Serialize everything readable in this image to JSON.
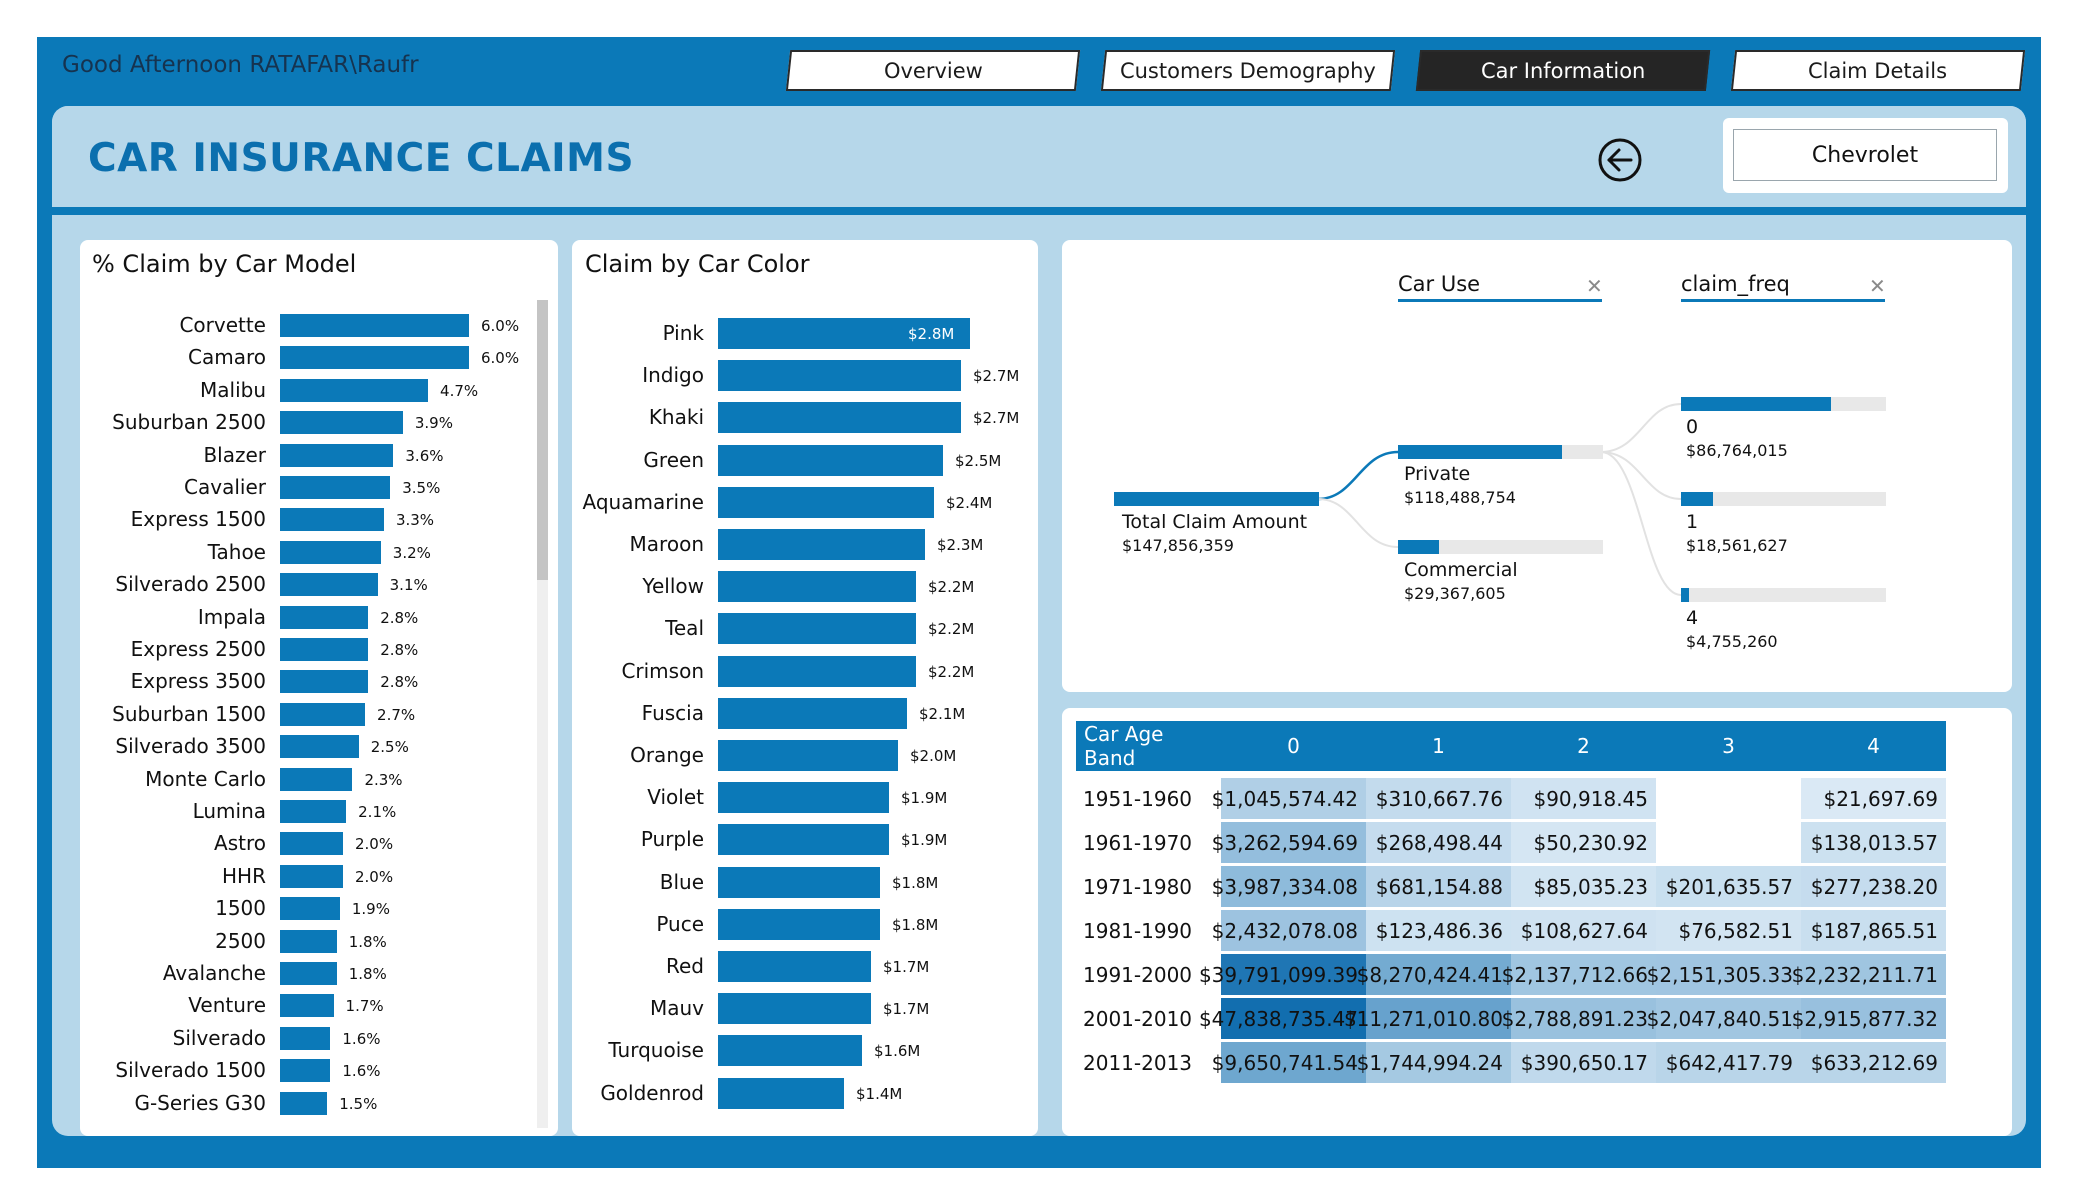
{
  "header": {
    "greeting": "Good Afternoon RATAFAR\\Raufr",
    "tabs": [
      {
        "label": "Overview",
        "active": false
      },
      {
        "label": "Customers Demography",
        "active": false
      },
      {
        "label": "Car Information",
        "active": true
      },
      {
        "label": "Claim Details",
        "active": false
      }
    ],
    "title": "CAR INSURANCE CLAIMS",
    "back_icon": "back-arrow-circle-icon",
    "brand_filter": "Chevrolet"
  },
  "colors": {
    "frame": "#0b79b8",
    "panel_bg": "#b6d7ea",
    "bar": "#0b79b8",
    "title": "#0b6fae",
    "active_tab": "#252525"
  },
  "model_chart": {
    "title": "% Claim by Car Model",
    "chart_data": {
      "type": "bar",
      "orientation": "horizontal",
      "categories": [
        "Corvette",
        "Camaro",
        "Malibu",
        "Suburban 2500",
        "Blazer",
        "Cavalier",
        "Express 1500",
        "Tahoe",
        "Silverado 2500",
        "Impala",
        "Express 2500",
        "Express 3500",
        "Suburban 1500",
        "Silverado 3500",
        "Monte Carlo",
        "Lumina",
        "Astro",
        "HHR",
        "1500",
        "2500",
        "Avalanche",
        "Venture",
        "Silverado",
        "Silverado 1500",
        "G-Series G30"
      ],
      "values": [
        6.0,
        6.0,
        4.7,
        3.9,
        3.6,
        3.5,
        3.3,
        3.2,
        3.1,
        2.8,
        2.8,
        2.8,
        2.7,
        2.5,
        2.3,
        2.1,
        2.0,
        2.0,
        1.9,
        1.8,
        1.8,
        1.7,
        1.6,
        1.6,
        1.5
      ],
      "value_labels": [
        "6.0%",
        "6.0%",
        "4.7%",
        "3.9%",
        "3.6%",
        "3.5%",
        "3.3%",
        "3.2%",
        "3.1%",
        "2.8%",
        "2.8%",
        "2.8%",
        "2.7%",
        "2.5%",
        "2.3%",
        "2.1%",
        "2.0%",
        "2.0%",
        "1.9%",
        "1.8%",
        "1.8%",
        "1.7%",
        "1.6%",
        "1.6%",
        "1.5%"
      ]
    }
  },
  "color_chart": {
    "title": "Claim by Car Color",
    "chart_data": {
      "type": "bar",
      "orientation": "horizontal",
      "categories": [
        "Pink",
        "Indigo",
        "Khaki",
        "Green",
        "Aquamarine",
        "Maroon",
        "Yellow",
        "Teal",
        "Crimson",
        "Fuscia",
        "Orange",
        "Violet",
        "Purple",
        "Blue",
        "Puce",
        "Red",
        "Mauv",
        "Turquoise",
        "Goldenrod"
      ],
      "values": [
        2.8,
        2.7,
        2.7,
        2.5,
        2.4,
        2.3,
        2.2,
        2.2,
        2.2,
        2.1,
        2.0,
        1.9,
        1.9,
        1.8,
        1.8,
        1.7,
        1.7,
        1.6,
        1.4
      ],
      "unit": "$M",
      "value_labels": [
        "$2.8M",
        "$2.7M",
        "$2.7M",
        "$2.5M",
        "$2.4M",
        "$2.3M",
        "$2.2M",
        "$2.2M",
        "$2.2M",
        "$2.1M",
        "$2.0M",
        "$1.9M",
        "$1.9M",
        "$1.8M",
        "$1.8M",
        "$1.7M",
        "$1.7M",
        "$1.6M",
        "$1.4M"
      ]
    }
  },
  "decomposition": {
    "levels": [
      {
        "label": "Car Use",
        "close_icon": "close-icon"
      },
      {
        "label": "claim_freq",
        "close_icon": "close-icon"
      }
    ],
    "root": {
      "label": "Total Claim Amount",
      "value": "$147,856,359",
      "amount": 147856359
    },
    "car_use": [
      {
        "label": "Private",
        "value": "$118,488,754",
        "amount": 118488754
      },
      {
        "label": "Commercial",
        "value": "$29,367,605",
        "amount": 29367605
      }
    ],
    "claim_freq": [
      {
        "label": "0",
        "value": "$86,764,015",
        "amount": 86764015
      },
      {
        "label": "1",
        "value": "$18,561,627",
        "amount": 18561627
      },
      {
        "label": "4",
        "value": "$4,755,260",
        "amount": 4755260
      }
    ]
  },
  "matrix": {
    "corner": "Car Age Band",
    "columns": [
      "0",
      "1",
      "2",
      "3",
      "4"
    ],
    "rows": [
      {
        "band": "1951-1960",
        "cells": [
          "$1,045,574.42",
          "$310,667.76",
          "$90,918.45",
          "",
          "$21,697.69"
        ],
        "amounts": [
          1045574.42,
          310667.76,
          90918.45,
          null,
          21697.69
        ]
      },
      {
        "band": "1961-1970",
        "cells": [
          "$3,262,594.69",
          "$268,498.44",
          "$50,230.92",
          "",
          "$138,013.57"
        ],
        "amounts": [
          3262594.69,
          268498.44,
          50230.92,
          null,
          138013.57
        ]
      },
      {
        "band": "1971-1980",
        "cells": [
          "$3,987,334.08",
          "$681,154.88",
          "$85,035.23",
          "$201,635.57",
          "$277,238.20"
        ],
        "amounts": [
          3987334.08,
          681154.88,
          85035.23,
          201635.57,
          277238.2
        ]
      },
      {
        "band": "1981-1990",
        "cells": [
          "$2,432,078.08",
          "$123,486.36",
          "$108,627.64",
          "$76,582.51",
          "$187,865.51"
        ],
        "amounts": [
          2432078.08,
          123486.36,
          108627.64,
          76582.51,
          187865.51
        ]
      },
      {
        "band": "1991-2000",
        "cells": [
          "$39,791,099.39",
          "$8,270,424.41",
          "$2,137,712.66",
          "$2,151,305.33",
          "$2,232,211.71"
        ],
        "amounts": [
          39791099.39,
          8270424.41,
          2137712.66,
          2151305.33,
          2232211.71
        ]
      },
      {
        "band": "2001-2010",
        "cells": [
          "$47,838,735.47",
          "$11,271,010.80",
          "$2,788,891.23",
          "$2,047,840.51",
          "$2,915,877.32"
        ],
        "amounts": [
          47838735.47,
          11271010.8,
          2788891.23,
          2047840.51,
          2915877.32
        ]
      },
      {
        "band": "2011-2013",
        "cells": [
          "$9,650,741.54",
          "$1,744,994.24",
          "$390,650.17",
          "$642,417.79",
          "$633,212.69"
        ],
        "amounts": [
          9650741.54,
          1744994.24,
          390650.17,
          642417.79,
          633212.69
        ]
      }
    ]
  }
}
